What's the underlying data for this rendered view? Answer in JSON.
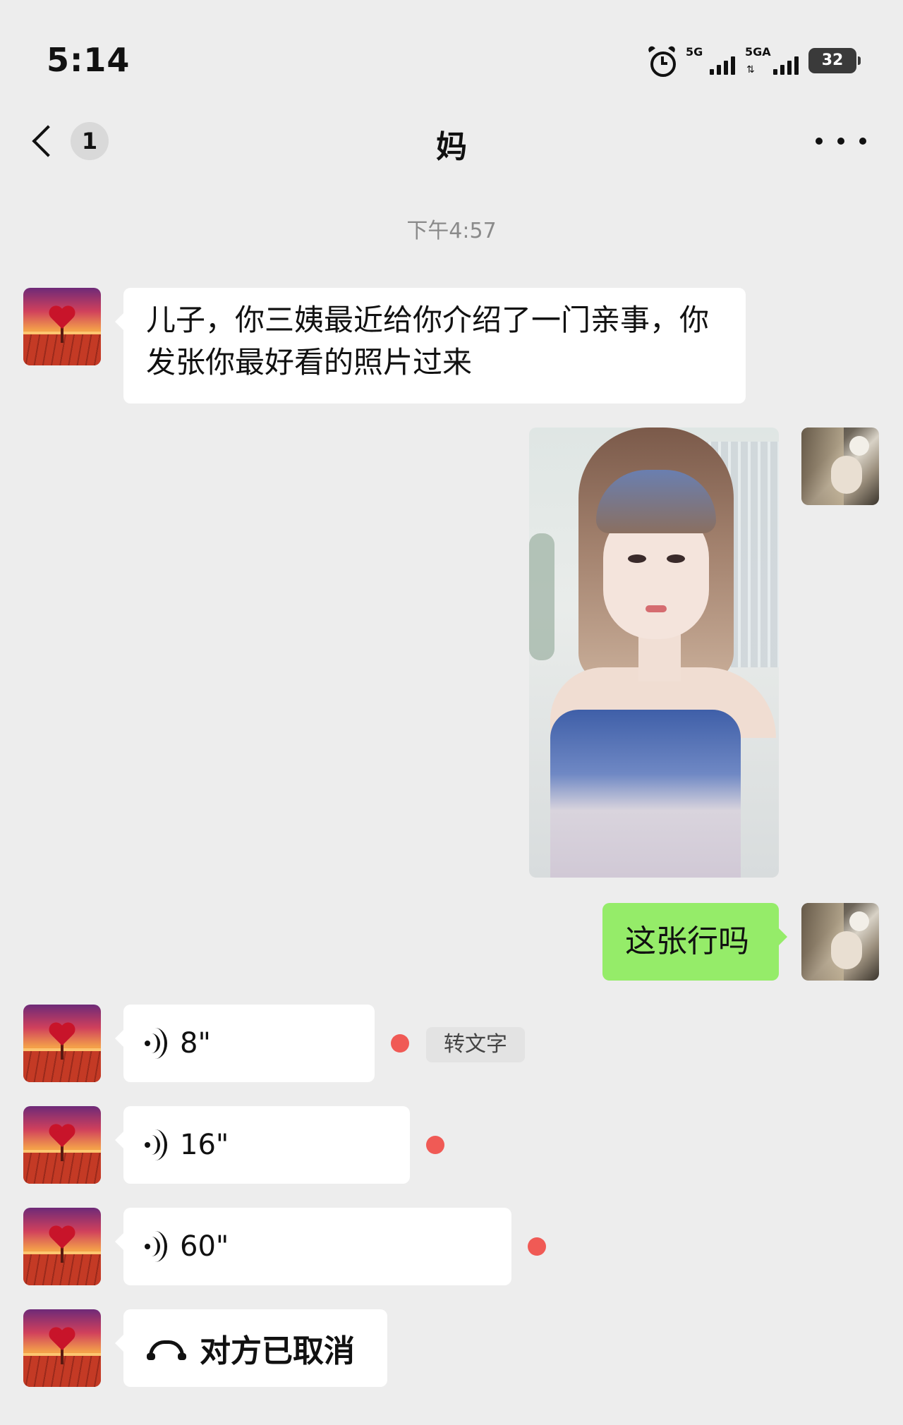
{
  "status_bar": {
    "time": "5:14",
    "network_1": "5G",
    "network_2": "5GA",
    "battery": "32"
  },
  "header": {
    "back_badge": "1",
    "title": "妈"
  },
  "messages": {
    "timestamp": "下午4:57",
    "mom_text": "儿子，你三姨最近给你介绍了一门亲事，你发张你最好看的照片过来",
    "my_text": "这张行吗",
    "voice": [
      {
        "duration": "8\"",
        "unread": true
      },
      {
        "duration": "16\"",
        "unread": true
      },
      {
        "duration": "60\"",
        "unread": true
      }
    ],
    "transcribe_label": "转文字",
    "call_status": "对方已取消"
  },
  "colors": {
    "background": "#ededed",
    "incoming_bubble": "#ffffff",
    "outgoing_bubble": "#95ec69",
    "unread_dot": "#f05a55"
  },
  "icons": {
    "status": [
      "alarm-icon",
      "signal-icon",
      "battery-icon"
    ],
    "nav": [
      "back-chevron-icon",
      "more-icon"
    ],
    "message": [
      "voice-icon",
      "phone-hangup-icon"
    ]
  }
}
